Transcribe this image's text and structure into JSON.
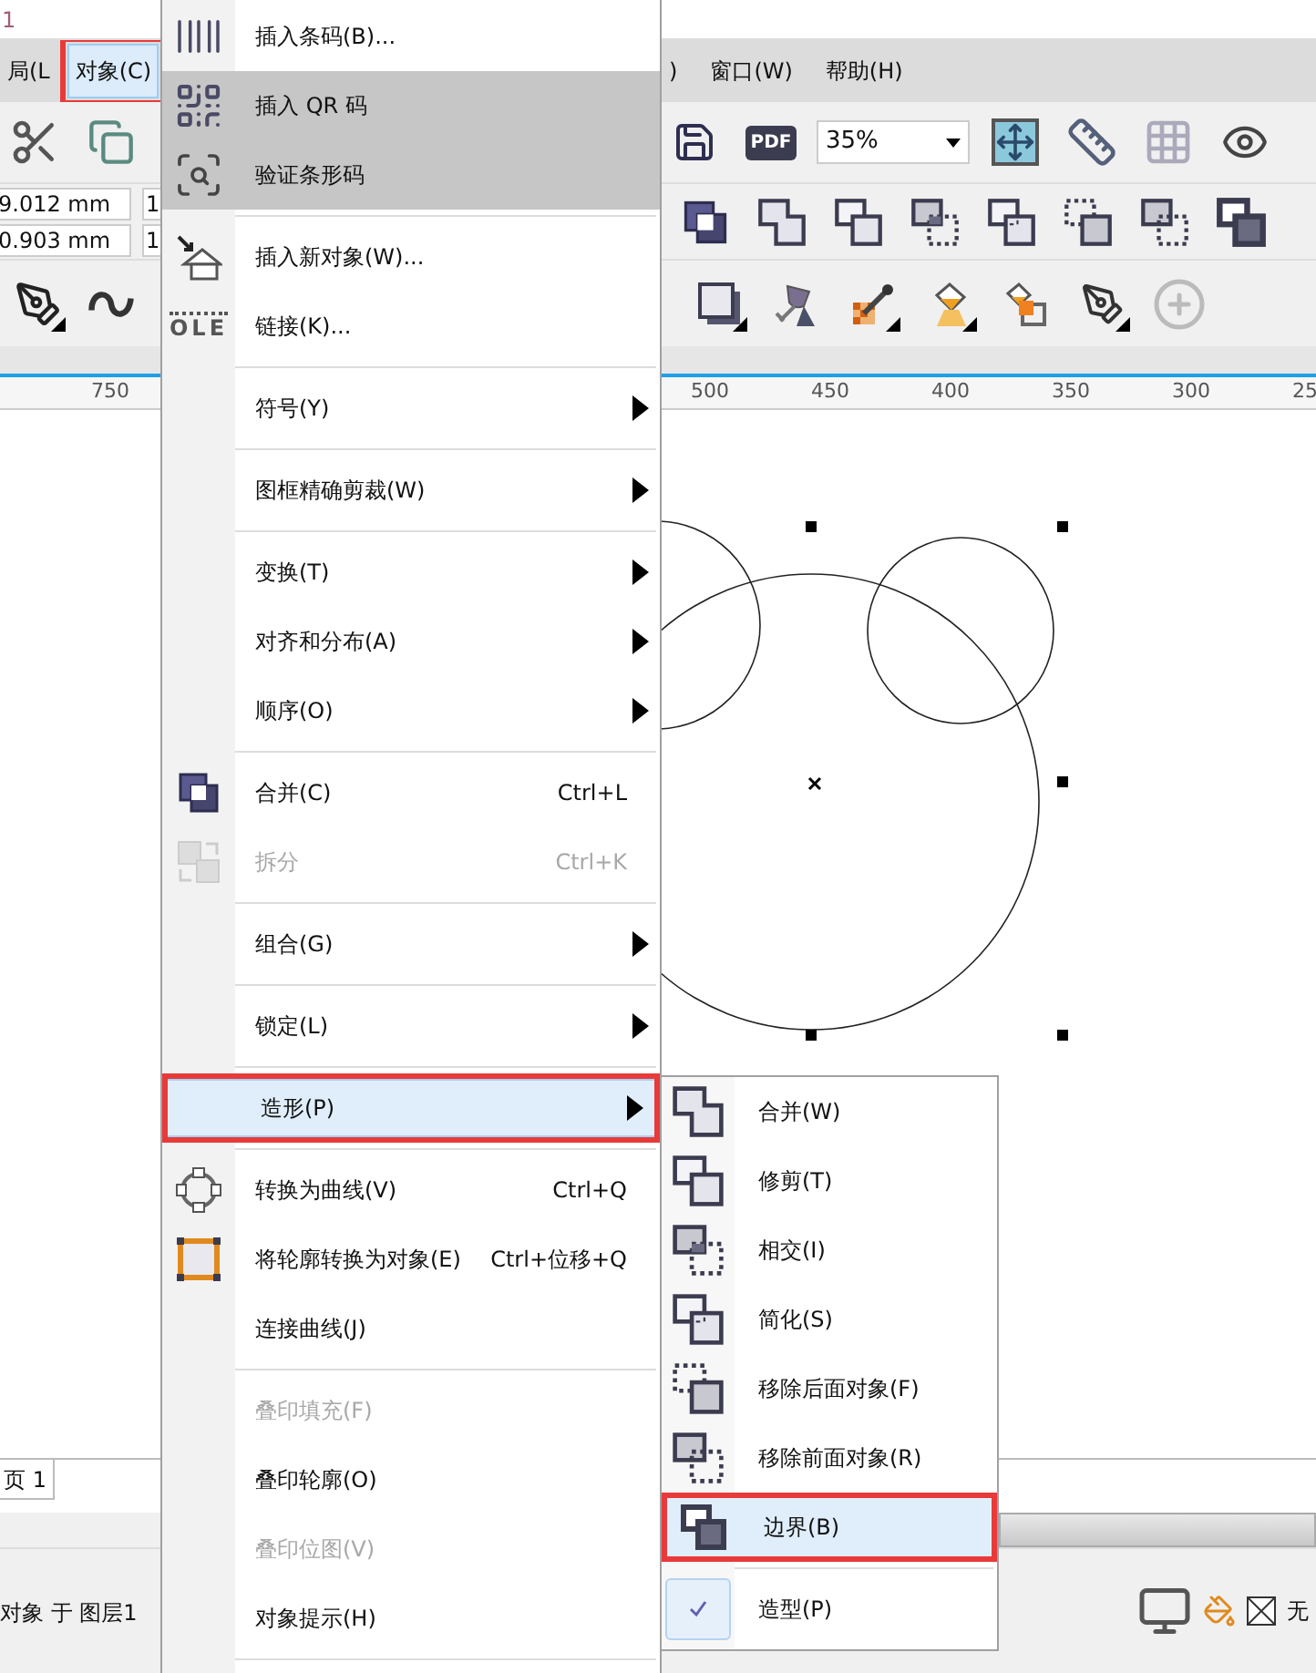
{
  "title_bar": {
    "text": "1"
  },
  "menubar": {
    "left_items": [
      {
        "label": "局(L",
        "selected": false,
        "annotated": false
      },
      {
        "label": "对象(C)",
        "selected": true,
        "annotated": true
      }
    ],
    "right_items": [
      {
        "label": ")",
        "selected": false,
        "annotated": false
      },
      {
        "label": "窗口(W)",
        "selected": false,
        "annotated": false
      },
      {
        "label": "帮助(H)",
        "selected": false,
        "annotated": false
      }
    ]
  },
  "toolbar": {
    "pdf_label": "PDF",
    "zoom": "35%"
  },
  "property_bar": {
    "x": "9.012 mm",
    "y": "0.903 mm",
    "field_3": "1",
    "field_4": "1"
  },
  "ruler": {
    "left_labels": [
      "750"
    ],
    "right_labels": [
      "500",
      "450",
      "400",
      "350",
      "300",
      "25"
    ]
  },
  "page_tab": {
    "label": "页 1"
  },
  "status_bar": {
    "text": "对象 于 图层1",
    "fill": "无"
  },
  "object_menu": {
    "groups": [
      [
        {
          "label": "插入条码(B)...",
          "disabled": false,
          "submenu": false,
          "shaded": false,
          "selected": false,
          "annotated": false
        },
        {
          "label": "插入 QR 码",
          "disabled": false,
          "submenu": false,
          "shaded": true,
          "selected": false,
          "annotated": false
        },
        {
          "label": "验证条形码",
          "disabled": false,
          "submenu": false,
          "shaded": true,
          "selected": false,
          "annotated": false
        }
      ],
      [
        {
          "label": "插入新对象(W)...",
          "disabled": false,
          "submenu": false,
          "shaded": false,
          "selected": false,
          "annotated": false
        },
        {
          "label": "链接(K)...",
          "icon_text": "OLE",
          "disabled": false,
          "submenu": false,
          "shaded": false,
          "selected": false,
          "annotated": false
        }
      ],
      [
        {
          "label": "符号(Y)",
          "disabled": false,
          "submenu": true,
          "shaded": false,
          "selected": false,
          "annotated": false
        }
      ],
      [
        {
          "label": "图框精确剪裁(W)",
          "disabled": false,
          "submenu": true,
          "shaded": false,
          "selected": false,
          "annotated": false
        }
      ],
      [
        {
          "label": "变换(T)",
          "disabled": false,
          "submenu": true,
          "shaded": false,
          "selected": false,
          "annotated": false
        },
        {
          "label": "对齐和分布(A)",
          "disabled": false,
          "submenu": true,
          "shaded": false,
          "selected": false,
          "annotated": false
        },
        {
          "label": "顺序(O)",
          "disabled": false,
          "submenu": true,
          "shaded": false,
          "selected": false,
          "annotated": false
        }
      ],
      [
        {
          "label": "合并(C)",
          "shortcut": "Ctrl+L",
          "disabled": false,
          "submenu": false,
          "shaded": false,
          "selected": false,
          "annotated": false
        },
        {
          "label": "拆分",
          "shortcut": "Ctrl+K",
          "disabled": true,
          "submenu": false,
          "shaded": false,
          "selected": false,
          "annotated": false
        }
      ],
      [
        {
          "label": "组合(G)",
          "disabled": false,
          "submenu": true,
          "shaded": false,
          "selected": false,
          "annotated": false
        }
      ],
      [
        {
          "label": "锁定(L)",
          "disabled": false,
          "submenu": true,
          "shaded": false,
          "selected": false,
          "annotated": false
        }
      ],
      [
        {
          "label": "造形(P)",
          "disabled": false,
          "submenu": true,
          "shaded": false,
          "selected": true,
          "annotated": true
        }
      ],
      [
        {
          "label": "转换为曲线(V)",
          "shortcut": "Ctrl+Q",
          "disabled": false,
          "submenu": false,
          "shaded": false,
          "selected": false,
          "annotated": false
        },
        {
          "label": "将轮廓转换为对象(E)",
          "shortcut": "Ctrl+位移+Q",
          "disabled": false,
          "submenu": false,
          "shaded": false,
          "selected": false,
          "annotated": false
        },
        {
          "label": "连接曲线(J)",
          "disabled": false,
          "submenu": false,
          "shaded": false,
          "selected": false,
          "annotated": false
        }
      ],
      [
        {
          "label": "叠印填充(F)",
          "disabled": true,
          "submenu": false,
          "shaded": false,
          "selected": false,
          "annotated": false
        },
        {
          "label": "叠印轮廓(O)",
          "disabled": false,
          "submenu": false,
          "shaded": false,
          "selected": false,
          "annotated": false
        },
        {
          "label": "叠印位图(V)",
          "disabled": true,
          "submenu": false,
          "shaded": false,
          "selected": false,
          "annotated": false
        },
        {
          "label": "对象提示(H)",
          "disabled": false,
          "submenu": false,
          "shaded": false,
          "selected": false,
          "annotated": false
        }
      ]
    ]
  },
  "shaping_submenu": {
    "items": [
      {
        "label": "合并(W)",
        "checked": false,
        "selected": false,
        "annotated": false
      },
      {
        "label": "修剪(T)",
        "checked": false,
        "selected": false,
        "annotated": false
      },
      {
        "label": "相交(I)",
        "checked": false,
        "selected": false,
        "annotated": false
      },
      {
        "label": "简化(S)",
        "checked": false,
        "selected": false,
        "annotated": false
      },
      {
        "label": "移除后面对象(F)",
        "checked": false,
        "selected": false,
        "annotated": false
      },
      {
        "label": "移除前面对象(R)",
        "checked": false,
        "selected": false,
        "annotated": false
      },
      {
        "label": "边界(B)",
        "checked": false,
        "selected": true,
        "annotated": true
      },
      {
        "label": "造型(P)",
        "checked": true,
        "selected": false,
        "annotated": false
      }
    ]
  }
}
